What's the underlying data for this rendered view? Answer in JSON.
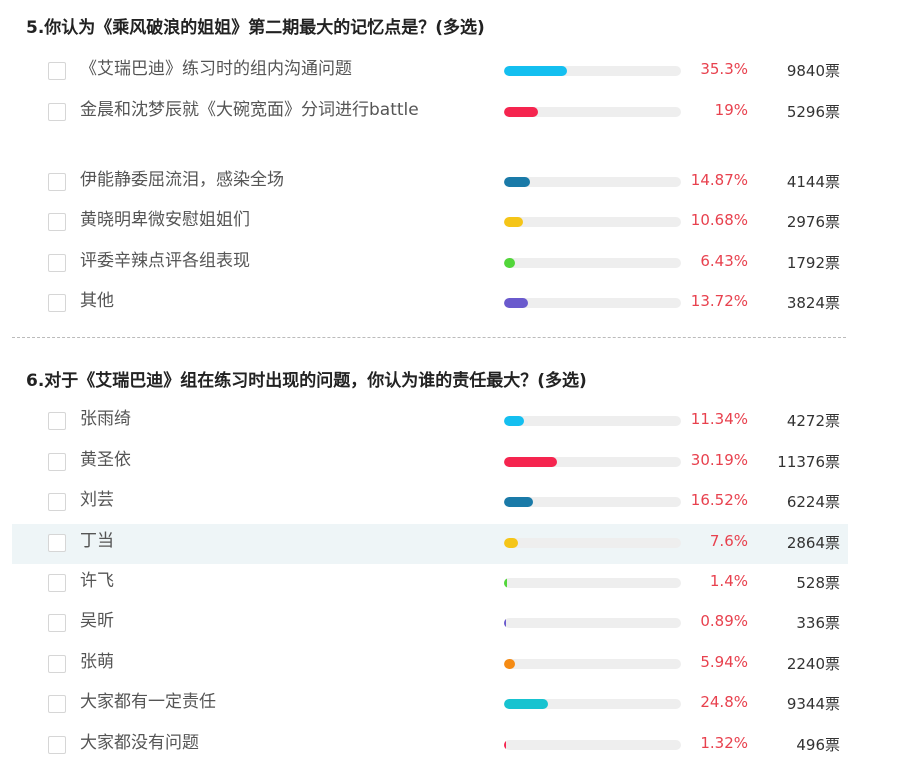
{
  "questions": [
    {
      "title": "5.你认为《乘风破浪的姐姐》第二期最大的记忆点是？(多选)",
      "options": [
        {
          "label": "《艾瑞巴迪》练习时的组内沟通问题",
          "percent_text": "35.3%",
          "percent": 35.3,
          "votes": "9840票",
          "color": "#14bff0"
        },
        {
          "label": "金晨和沈梦辰就《大碗宽面》分词进行battle",
          "percent_text": "19%",
          "percent": 19,
          "votes": "5296票",
          "color": "#f5254f"
        },
        {
          "label": "伊能静委屈流泪，感染全场",
          "percent_text": "14.87%",
          "percent": 14.87,
          "votes": "4144票",
          "color": "#1a7aa8"
        },
        {
          "label": "黄晓明卑微安慰姐姐们",
          "percent_text": "10.68%",
          "percent": 10.68,
          "votes": "2976票",
          "color": "#f5c518"
        },
        {
          "label": "评委辛辣点评各组表现",
          "percent_text": "6.43%",
          "percent": 6.43,
          "votes": "1792票",
          "color": "#52d63a"
        },
        {
          "label": "其他",
          "percent_text": "13.72%",
          "percent": 13.72,
          "votes": "3824票",
          "color": "#6a5acd"
        }
      ]
    },
    {
      "title": "6.对于《艾瑞巴迪》组在练习时出现的问题，你认为谁的责任最大？(多选)",
      "options": [
        {
          "label": "张雨绮",
          "percent_text": "11.34%",
          "percent": 11.34,
          "votes": "4272票",
          "color": "#14bff0"
        },
        {
          "label": "黄圣依",
          "percent_text": "30.19%",
          "percent": 30.19,
          "votes": "11376票",
          "color": "#f5254f"
        },
        {
          "label": "刘芸",
          "percent_text": "16.52%",
          "percent": 16.52,
          "votes": "6224票",
          "color": "#1a7aa8"
        },
        {
          "label": "丁当",
          "percent_text": "7.6%",
          "percent": 7.6,
          "votes": "2864票",
          "color": "#f5c518",
          "highlighted": true
        },
        {
          "label": "许飞",
          "percent_text": "1.4%",
          "percent": 1.4,
          "votes": "528票",
          "color": "#52d63a"
        },
        {
          "label": "吴昕",
          "percent_text": "0.89%",
          "percent": 0.89,
          "votes": "336票",
          "color": "#6a5acd"
        },
        {
          "label": "张萌",
          "percent_text": "5.94%",
          "percent": 5.94,
          "votes": "2240票",
          "color": "#f58b14"
        },
        {
          "label": "大家都有一定责任",
          "percent_text": "24.8%",
          "percent": 24.8,
          "votes": "9344票",
          "color": "#17c3d0"
        },
        {
          "label": "大家都没有问题",
          "percent_text": "1.32%",
          "percent": 1.32,
          "votes": "496票",
          "color": "#f5254f"
        }
      ]
    }
  ]
}
